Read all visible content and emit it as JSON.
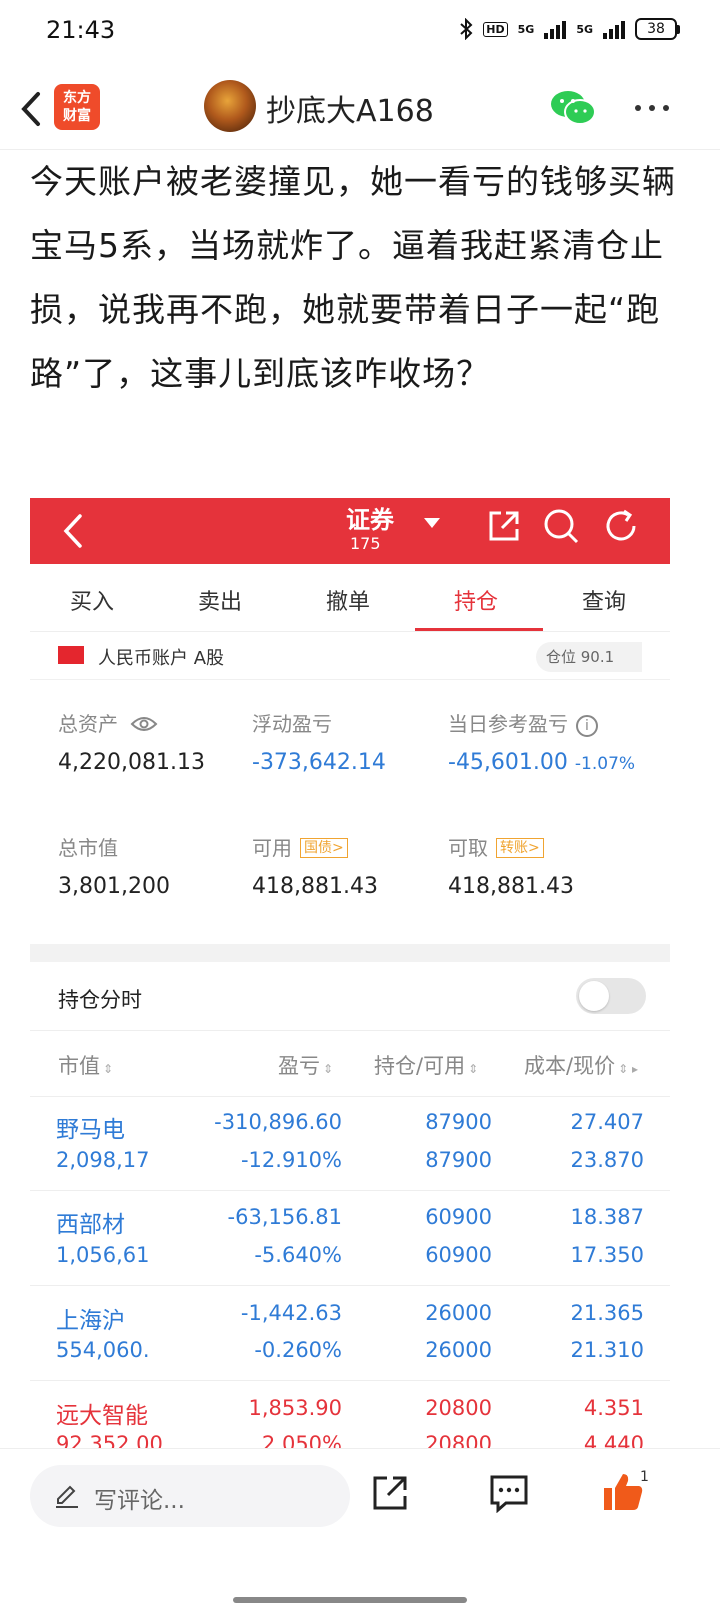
{
  "status_bar": {
    "time": "21:43",
    "network_hd": "HD",
    "network_1": "5G",
    "network_2": "5G",
    "battery": "38"
  },
  "header": {
    "back_label": "<",
    "app_logo_text_1": "东方",
    "app_logo_text_2": "财富",
    "username": "抄底大A168"
  },
  "post": {
    "text": "今天账户被老婆撞见，她一看亏的钱够买辆宝马5系，当场就炸了。逼着我赶紧清仓止损，说我再不跑，她就要带着日子一起“跑路”了，这事儿到底该咋收场？"
  },
  "screenshot": {
    "broker_title": "证券",
    "broker_sub": "175",
    "tabs": [
      "买入",
      "卖出",
      "撤单",
      "持仓",
      "查询"
    ],
    "active_tab": "持仓",
    "account_label": "人民币账户 A股",
    "position_ratio": "仓位 90.1",
    "summary": {
      "total_assets_label": "总资产",
      "total_assets": "4,220,081.13",
      "floating_pl_label": "浮动盈亏",
      "floating_pl": "-373,642.14",
      "daily_pl_label": "当日参考盈亏",
      "daily_pl": "-45,601.00",
      "daily_pl_pct": "-1.07%",
      "market_value_label": "总市值",
      "market_value": "3,801,200",
      "available_label": "可用",
      "available_tag": "国债>",
      "available": "418,881.43",
      "withdrawable_label": "可取",
      "withdrawable_tag": "转账>",
      "withdrawable": "418,881.43"
    },
    "hold_time_label": "持仓分时",
    "columns": [
      "市值",
      "盈亏",
      "持仓/可用",
      "成本/现价"
    ],
    "rows": [
      {
        "name": "野马电",
        "mv": "2,098,17",
        "pl": "-310,896.60",
        "pl_pct": "-12.910%",
        "qty": "87900",
        "avail": "87900",
        "cost": "27.407",
        "price": "23.870",
        "color": "blue"
      },
      {
        "name": "西部材",
        "mv": "1,056,61",
        "pl": "-63,156.81",
        "pl_pct": "-5.640%",
        "qty": "60900",
        "avail": "60900",
        "cost": "18.387",
        "price": "17.350",
        "color": "blue"
      },
      {
        "name": "上海沪",
        "mv": "554,060.",
        "pl": "-1,442.63",
        "pl_pct": "-0.260%",
        "qty": "26000",
        "avail": "26000",
        "cost": "21.365",
        "price": "21.310",
        "color": "blue"
      },
      {
        "name": "远大智能",
        "mv": "92,352.00",
        "pl": "1,853.90",
        "pl_pct": "2.050%",
        "qty": "20800",
        "avail": "20800",
        "cost": "4.351",
        "price": "4.440",
        "color": "red"
      }
    ]
  },
  "bottom": {
    "comment_placeholder": "写评论...",
    "like_count": "1"
  },
  "colors": {
    "broker_red": "#e5333b",
    "loss_blue": "#2f7bd6",
    "tag_orange": "#f0a431"
  }
}
